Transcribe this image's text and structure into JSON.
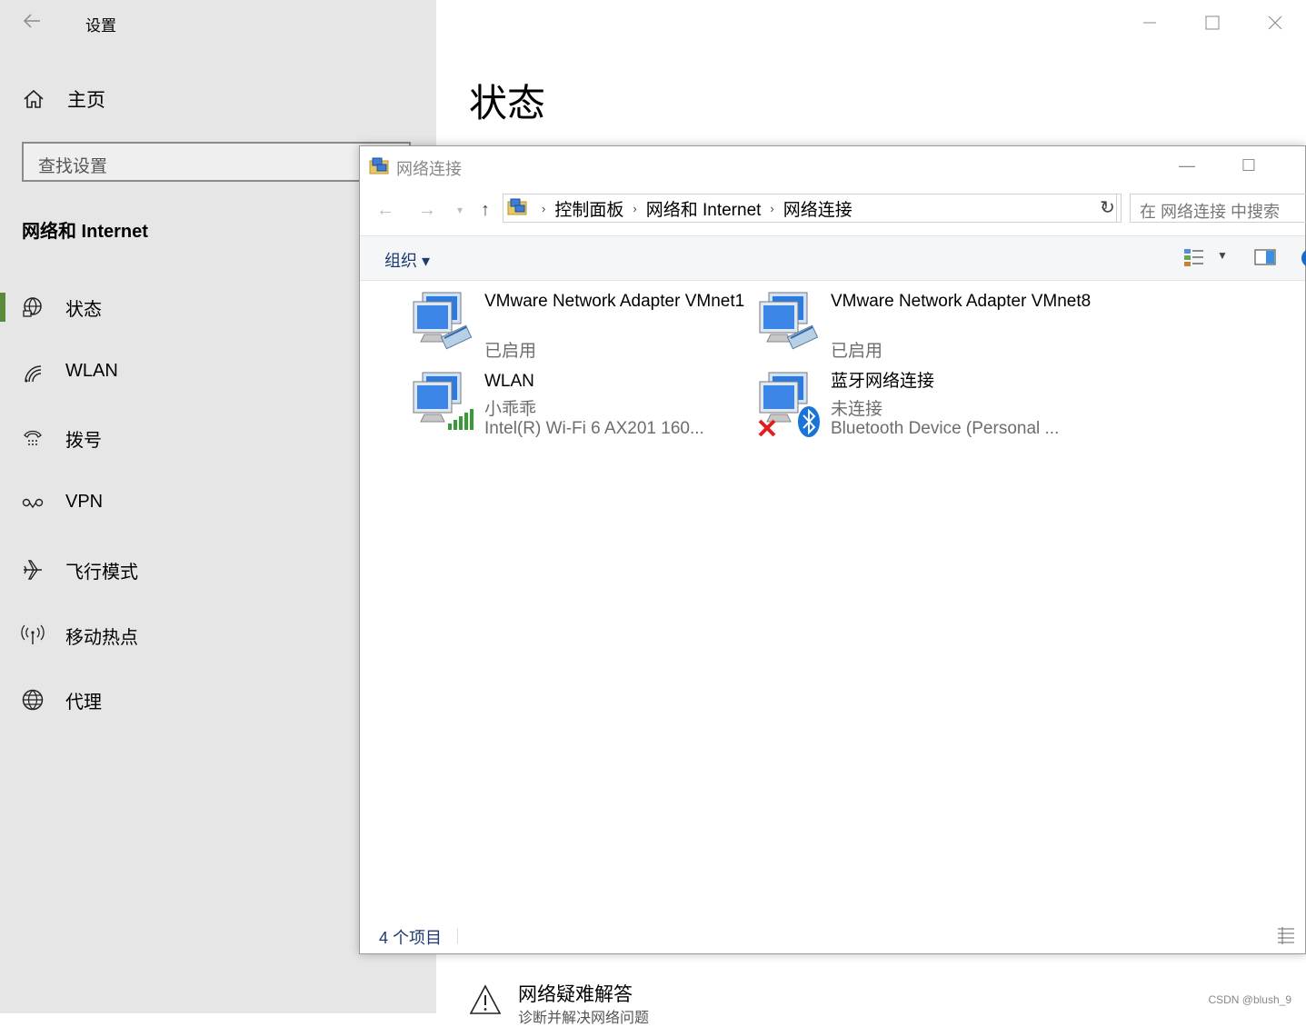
{
  "settings": {
    "app_title": "设置",
    "home_label": "主页",
    "search_placeholder": "查找设置",
    "section_title": "网络和 Internet",
    "nav_items": [
      {
        "label": "状态",
        "icon": "globe-network-icon",
        "selected": true
      },
      {
        "label": "WLAN",
        "icon": "wifi-icon",
        "selected": false
      },
      {
        "label": "拨号",
        "icon": "dialup-icon",
        "selected": false
      },
      {
        "label": "VPN",
        "icon": "vpn-icon",
        "selected": false
      },
      {
        "label": "飞行模式",
        "icon": "airplane-icon",
        "selected": false
      },
      {
        "label": "移动热点",
        "icon": "hotspot-icon",
        "selected": false
      },
      {
        "label": "代理",
        "icon": "globe-icon",
        "selected": false
      }
    ],
    "page_heading": "状态",
    "troubleshoot_title": "网络疑难解答",
    "troubleshoot_subtitle": "诊断并解决网络问题",
    "accent_color": "#5a8a3a"
  },
  "explorer": {
    "title": "网络连接",
    "breadcrumb": [
      "控制面板",
      "网络和 Internet",
      "网络连接"
    ],
    "search_placeholder": "在 网络连接 中搜索",
    "organize_label": "组织 ▾",
    "items": [
      {
        "name": "VMware Network Adapter VMnet1",
        "line1": "已启用",
        "line2": "",
        "icon": "network-adapter-icon"
      },
      {
        "name": "VMware Network Adapter VMnet8",
        "line1": "已启用",
        "line2": "",
        "icon": "network-adapter-icon"
      },
      {
        "name": "WLAN",
        "line1": "小乖乖",
        "line2": "Intel(R) Wi-Fi 6 AX201 160...",
        "icon": "wifi-adapter-icon"
      },
      {
        "name": "蓝牙网络连接",
        "line1": "未连接",
        "line2": "Bluetooth Device (Personal ...",
        "icon": "bluetooth-adapter-icon"
      }
    ],
    "status_count": "4 个项目"
  },
  "watermark": "CSDN @blush_9"
}
